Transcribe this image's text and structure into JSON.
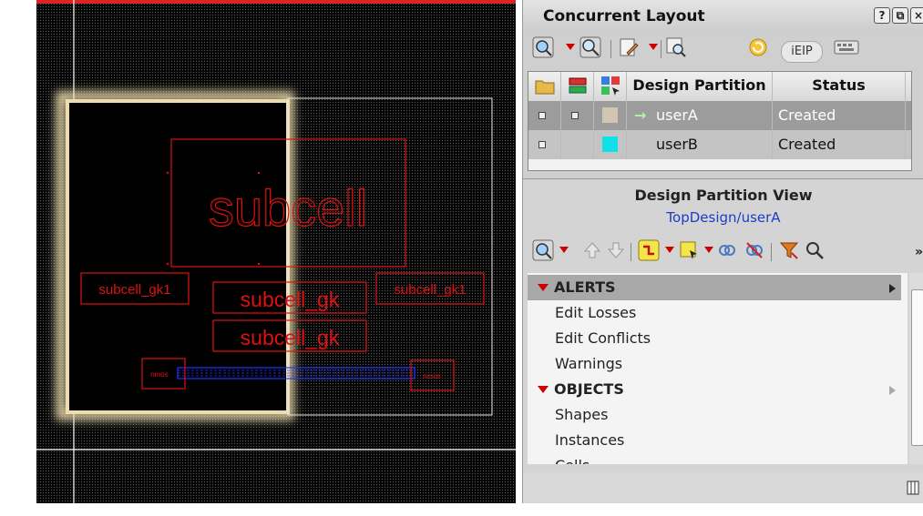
{
  "canvas": {
    "labels": {
      "subcell": "subcell",
      "subcell_gk1_left": "subcell_gk1",
      "subcell_gk1_right": "subcell_gk1",
      "subcell_gk_a": "subcell_gk",
      "subcell_gk_b": "subcell_gk",
      "pin_left": "nmos",
      "pin_right": "nmos"
    },
    "colors": {
      "background": "#050505",
      "geometry": "#e01010",
      "net": "#2233ff",
      "highlight": "#f3e2b0"
    }
  },
  "panel": {
    "title": "Concurrent Layout",
    "window_buttons": [
      "?",
      "⧉",
      "×"
    ],
    "toolbar": {
      "icons": [
        "zoom-fit-icon",
        "zoom-select-icon",
        "edit-icon",
        "probe-icon",
        "refresh-icon",
        "ieip-toggle",
        "keyboard-icon"
      ],
      "ieip_label": "iEIP"
    },
    "table": {
      "columns": [
        "Design Partition",
        "Status"
      ],
      "rows": [
        {
          "name": "userA",
          "status": "Created",
          "color": "#d2c6b0",
          "current": true
        },
        {
          "name": "userB",
          "status": "Created",
          "color": "#11e0e8",
          "current": false
        }
      ]
    },
    "partition_view": {
      "title": "Design Partition View",
      "path": "TopDesign/userA",
      "groups": [
        {
          "name": "ALERTS",
          "items": [
            "Edit Losses",
            "Edit Conflicts",
            "Warnings"
          ]
        },
        {
          "name": "OBJECTS",
          "items": [
            "Shapes",
            "Instances",
            "Cells"
          ]
        }
      ]
    }
  }
}
